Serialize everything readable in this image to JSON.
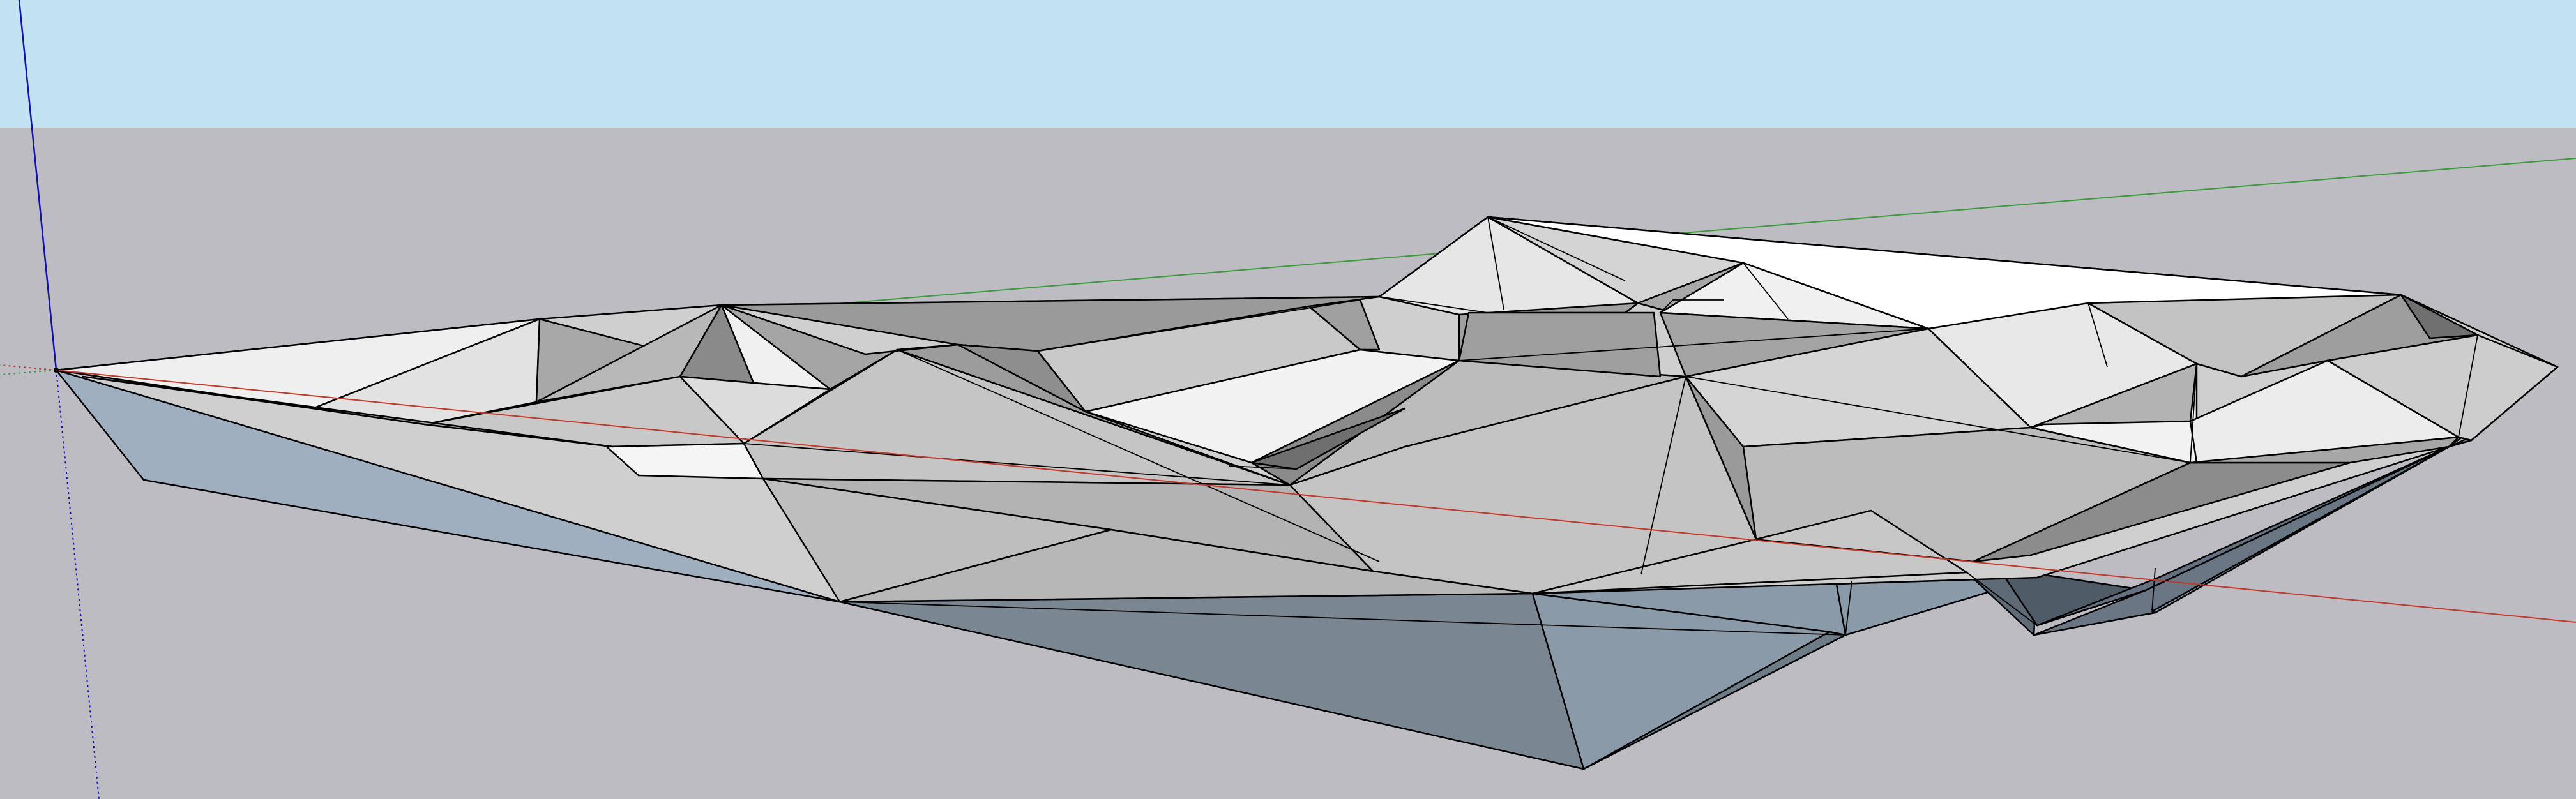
{
  "viewport": {
    "sky_color": "#c2e2f2",
    "ground_color": "#bdbcc3",
    "edge_color": "#000000",
    "axes": {
      "red_axis_color": "#c0392b",
      "green_axis_color": "#3c9a3c",
      "blue_axis_color": "#1010b0"
    },
    "model": {
      "name": "terrain-mesh",
      "side_face_colors": [
        "#a0afbf",
        "#7a8792",
        "#8a9aa8",
        "#4e5a66"
      ],
      "top_face_colors": [
        "#f4f4f4",
        "#e4e4e4",
        "#cfcfcf",
        "#bdbdbd",
        "#a6a6a6",
        "#8c8c8c",
        "#6f6f6f"
      ]
    }
  }
}
